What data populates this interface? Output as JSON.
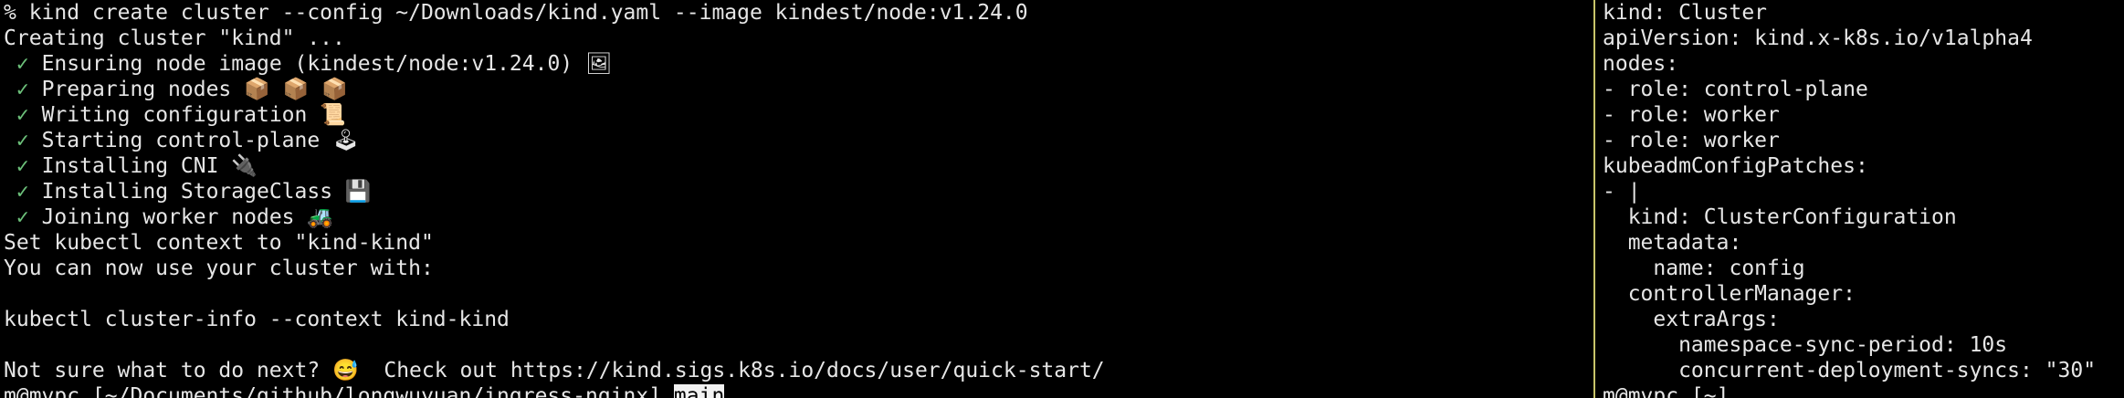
{
  "colors": {
    "background": "#000000",
    "text": "#e6e6e6",
    "check": "#6cc07a",
    "divider": "#c8c46a"
  },
  "left_pane": {
    "command": "% kind create cluster --config ~/Downloads/kind.yaml --image kindest/node:v1.24.0",
    "creating": "Creating cluster \"kind\" ...",
    "steps": [
      {
        "check": "✓",
        "text": " Ensuring node image (kindest/node:v1.24.0) ",
        "icon": "🖼",
        "icon_name": "image-icon"
      },
      {
        "check": "✓",
        "text": " Preparing nodes ",
        "icon": "📦 📦 📦",
        "icon_name": "package-icon"
      },
      {
        "check": "✓",
        "text": " Writing configuration ",
        "icon": "📜",
        "icon_name": "scroll-icon"
      },
      {
        "check": "✓",
        "text": " Starting control-plane ",
        "icon": "🕹",
        "icon_name": "joystick-icon"
      },
      {
        "check": "✓",
        "text": " Installing CNI ",
        "icon": "🔌",
        "icon_name": "plug-icon"
      },
      {
        "check": "✓",
        "text": " Installing StorageClass ",
        "icon": "💾",
        "icon_name": "floppy-disk-icon"
      },
      {
        "check": "✓",
        "text": " Joining worker nodes ",
        "icon": "🚜",
        "icon_name": "tractor-icon"
      }
    ],
    "context_set": "Set kubectl context to \"kind-kind\"",
    "usage": "You can now use your cluster with:",
    "cluster_info_cmd": "kubectl cluster-info --context kind-kind",
    "next_prefix": "Not sure what to do next? ",
    "next_icon": "😅",
    "next_icon_name": "smile-sweat-icon",
    "next_suffix": "  Check out https://kind.sigs.k8s.io/docs/user/quick-start/",
    "prompt": "m@mvpc [~/Documents/github/longwuyuan/ingress-nginx] ",
    "branch": "main"
  },
  "right_pane": {
    "lines": [
      "kind: Cluster",
      "apiVersion: kind.x-k8s.io/v1alpha4",
      "nodes:",
      "- role: control-plane",
      "- role: worker",
      "- role: worker",
      "kubeadmConfigPatches:",
      "- |",
      "  kind: ClusterConfiguration",
      "  metadata:",
      "    name: config",
      "  controllerManager:",
      "    extraArgs:",
      "      namespace-sync-period: 10s",
      "      concurrent-deployment-syncs: \"30\""
    ],
    "prompt": "m@mvpc [~]"
  }
}
